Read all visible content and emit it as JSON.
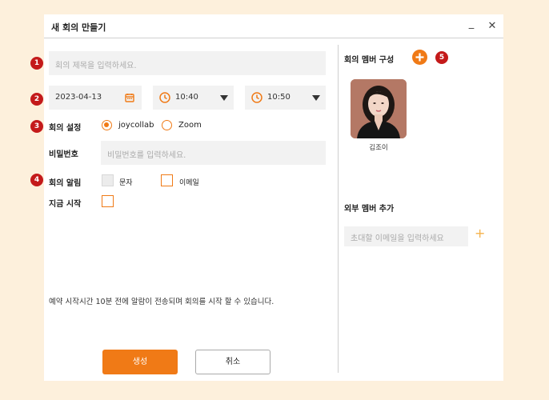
{
  "window": {
    "title": "새 회의 만들기",
    "minimize": "_",
    "close": "✕"
  },
  "badges": [
    "1",
    "2",
    "3",
    "4",
    "5"
  ],
  "form": {
    "title_placeholder": "회의 제목을 입력하세요.",
    "date": "2023-04-13",
    "start_time": "10:40",
    "end_time": "10:50",
    "settings_label": "회의 설정",
    "platform_options": [
      "joycollab",
      "Zoom"
    ],
    "platform_selected": "joycollab",
    "password_label": "비밀번호",
    "password_placeholder": "비밀번호를 입력하세요.",
    "alarm_label": "회의 알림",
    "alarm_sms": "문자",
    "alarm_email": "이메일",
    "start_now_label": "지금 시작",
    "notice": "예약 시작시간 10분 전에 알람이 전송되며 회의를 시작 할 수 있습니다.",
    "create_button": "생성",
    "cancel_button": "취소"
  },
  "members": {
    "title": "회의 멤버 구성",
    "list": [
      {
        "name": "김조이"
      }
    ]
  },
  "external": {
    "title": "외부 멤버 추가",
    "email_placeholder": "초대할 이메일을 입력하세요",
    "add_symbol": "+"
  },
  "colors": {
    "accent": "#f07a16",
    "badge": "#c41a1a",
    "background": "#fdf0dc"
  }
}
